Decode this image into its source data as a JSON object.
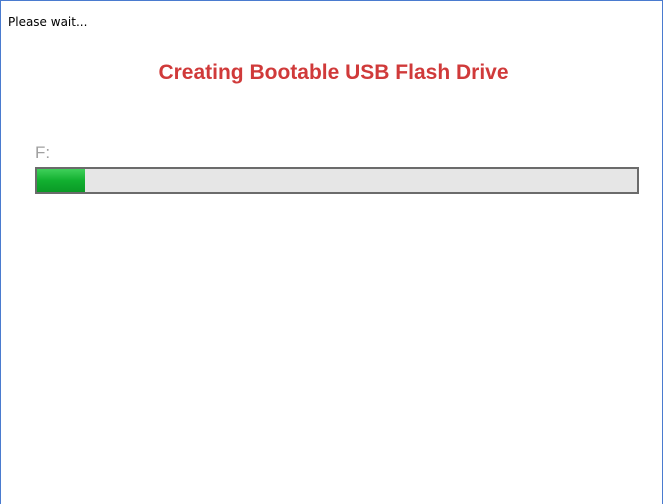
{
  "window": {
    "status_text": "Please wait..."
  },
  "main": {
    "heading": "Creating Bootable USB Flash Drive",
    "drive_label": "F:",
    "progress_fraction": 0.08
  },
  "colors": {
    "heading": "#d03a3a",
    "progress": "#12b030",
    "window_border": "#4a7bcf"
  }
}
